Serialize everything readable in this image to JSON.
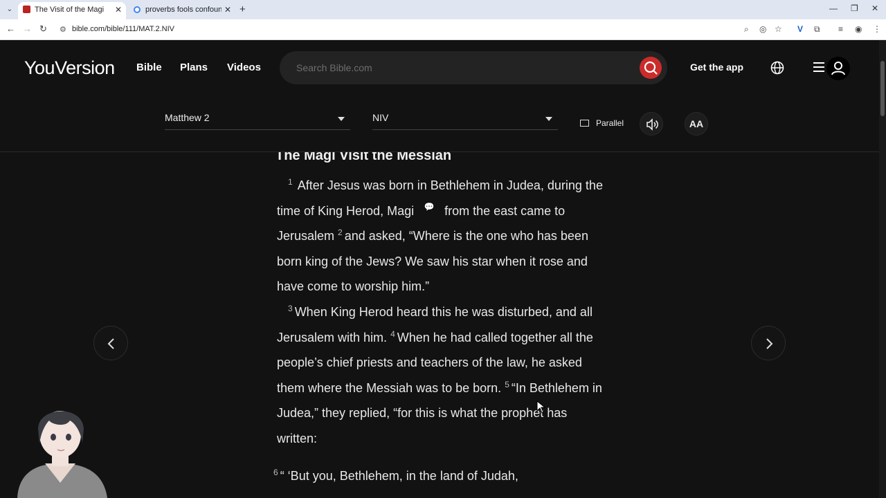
{
  "browser": {
    "tabs": [
      {
        "title": "The Visit of the Magi",
        "active": true
      },
      {
        "title": "proverbs fools confound the w",
        "active": false
      }
    ],
    "url": "bible.com/bible/111/MAT.2.NIV"
  },
  "header": {
    "logo": "YouVersion",
    "nav": [
      "Bible",
      "Plans",
      "Videos"
    ],
    "search_placeholder": "Search Bible.com",
    "get_app": "Get the app"
  },
  "toolbar": {
    "book_chapter": "Matthew 2",
    "version": "NIV",
    "parallel": "Parallel",
    "font_size_label": "AA"
  },
  "passage": {
    "heading": "The Magi Visit the Messiah",
    "v1_num": "1",
    "v1a": "After Jesus was born in Bethlehem in Judea, during the time of King Herod, Magi",
    "v1b": "from the east came to Jerusalem",
    "v2_num": "2",
    "v2": "and asked, “Where is the one who has been born king of the Jews? We saw his star when it rose and have come to worship him.”",
    "v3_num": "3",
    "v3": "When King Herod heard this he was disturbed, and all Jerusalem with him.",
    "v4_num": "4",
    "v4": "When he had called together all the people’s chief priests and teachers of the law, he asked them where the Messiah was to be born.",
    "v5_num": "5",
    "v5": "“In Bethlehem in Judea,” they replied, “for this is what the prophet has written:",
    "v6_num": "6",
    "v6": "“ ‘But you, Bethlehem, in the land of Judah,"
  }
}
